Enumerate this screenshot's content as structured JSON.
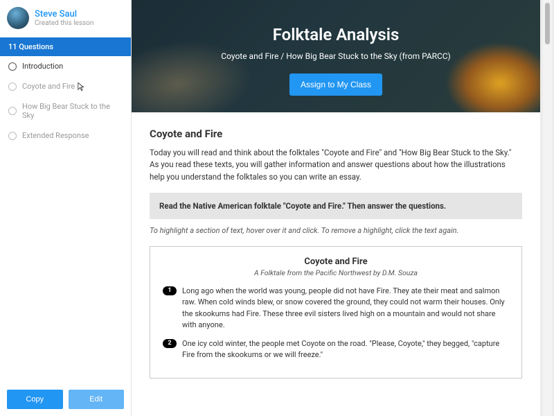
{
  "author": {
    "name": "Steve Saul",
    "sub": "Created this lesson"
  },
  "sidebar": {
    "count_label": "11 Questions",
    "items": [
      {
        "label": "Introduction"
      },
      {
        "label": "Coyote and Fire"
      },
      {
        "label": "How Big Bear Stuck to the Sky"
      },
      {
        "label": "Extended Response"
      }
    ],
    "copy_label": "Copy",
    "edit_label": "Edit"
  },
  "hero": {
    "title": "Folktale Analysis",
    "subtitle": "Coyote and Fire / How Big Bear Stuck to the Sky (from PARCC)",
    "assign_label": "Assign to My Class"
  },
  "content": {
    "heading": "Coyote and Fire",
    "intro": "Today you will read and think about the folktales \"Coyote and Fire\" and \"How Big Bear Stuck to the Sky.\" As you read these texts, you will gather information and answer questions about how the illustrations help you understand the folktales so you can write an essay.",
    "callout": "Read the Native American folktale \"Coyote and Fire.\" Then answer the questions.",
    "instructions": "To highlight a section of text, hover over it and click. To remove a highlight, click the text again.",
    "passage": {
      "title": "Coyote and Fire",
      "sub": "A Folktale from the Pacific Northwest by D.M. Souza",
      "paragraphs": [
        {
          "num": "1",
          "text": "Long ago when the world was young, people did not have Fire.  They ate their meat and salmon raw.  When cold winds blew, or snow covered the ground, they could not warm their houses.  Only the skookums had Fire.  These three evil sisters lived high on a mountain and would not share with anyone."
        },
        {
          "num": "2",
          "text": "One icy cold winter, the people met Coyote on the road.  \"Please, Coyote,\" they begged, \"capture Fire from the skookums or we will freeze.\""
        }
      ]
    }
  }
}
